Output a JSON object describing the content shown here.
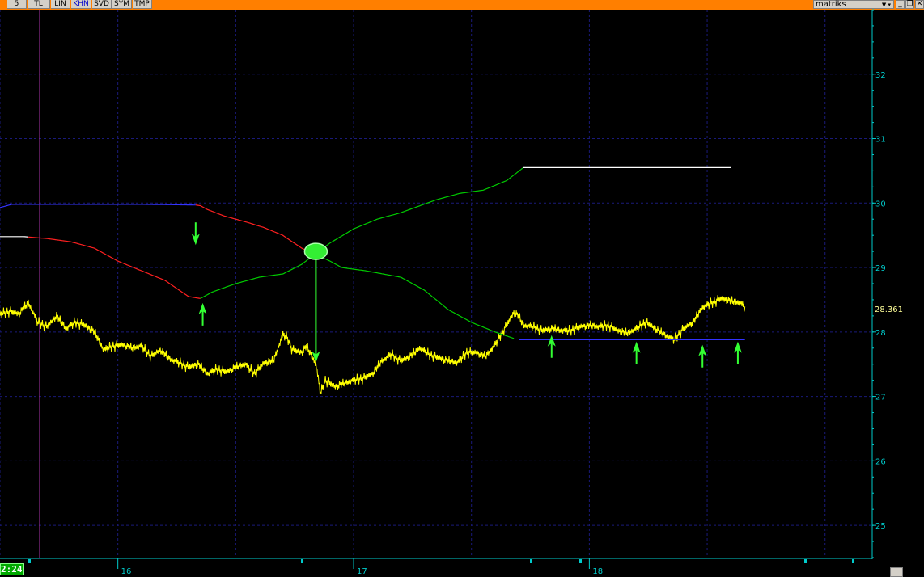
{
  "toolbar": {
    "buttons": [
      {
        "label": "5",
        "active": false
      },
      {
        "label": "TL",
        "active": false
      },
      {
        "label": "LIN",
        "active": false
      },
      {
        "label": "KHN",
        "active": true
      },
      {
        "label": "SVD",
        "active": false
      },
      {
        "label": "SYM",
        "active": false
      },
      {
        "label": "TMP",
        "active": false
      }
    ],
    "brand": "matriks",
    "brand_arrows": "▼ ▾",
    "window_buttons": [
      "_",
      "❐",
      "✕"
    ]
  },
  "status": {
    "time": "2:24"
  },
  "colors": {
    "background": "#000000",
    "price": "#ffff00",
    "channel_top": "#00cc00",
    "channel_bottom": "#ff2020",
    "level_line": "#3333ff",
    "annotation": "#33ff33",
    "axis": "#00cccc",
    "grid": "#1a1a7a"
  },
  "icons": [
    "arrow-down-icon",
    "arrow-up-icon",
    "crossover-marker-icon"
  ],
  "chart_data": {
    "type": "line",
    "title": "",
    "xlabel": "",
    "ylabel": "",
    "ylim": [
      24.5,
      33
    ],
    "yticks": [
      25,
      26,
      27,
      28,
      29,
      30,
      31,
      32
    ],
    "xlim": [
      15.5,
      19.2
    ],
    "xticks": [
      {
        "label": "16",
        "value": 16
      },
      {
        "label": "17",
        "value": 17
      },
      {
        "label": "18",
        "value": 18
      }
    ],
    "grid": true,
    "last_value": {
      "label": "28.361",
      "value": 28.361
    },
    "series": [
      {
        "role": "price",
        "color": "#ffff00",
        "points": [
          [
            15.5,
            28.27
          ],
          [
            15.54,
            28.32
          ],
          [
            15.58,
            28.28
          ],
          [
            15.62,
            28.45
          ],
          [
            15.66,
            28.15
          ],
          [
            15.7,
            28.08
          ],
          [
            15.74,
            28.25
          ],
          [
            15.78,
            28.05
          ],
          [
            15.82,
            28.15
          ],
          [
            15.86,
            28.1
          ],
          [
            15.9,
            28.0
          ],
          [
            15.94,
            27.72
          ],
          [
            15.98,
            27.78
          ],
          [
            16.02,
            27.8
          ],
          [
            16.06,
            27.75
          ],
          [
            16.1,
            27.78
          ],
          [
            16.14,
            27.62
          ],
          [
            16.18,
            27.72
          ],
          [
            16.22,
            27.58
          ],
          [
            16.26,
            27.52
          ],
          [
            16.3,
            27.45
          ],
          [
            16.34,
            27.5
          ],
          [
            16.38,
            27.35
          ],
          [
            16.42,
            27.42
          ],
          [
            16.46,
            27.38
          ],
          [
            16.5,
            27.45
          ],
          [
            16.54,
            27.5
          ],
          [
            16.58,
            27.35
          ],
          [
            16.62,
            27.52
          ],
          [
            16.66,
            27.55
          ],
          [
            16.7,
            27.96
          ],
          [
            16.72,
            27.9
          ],
          [
            16.74,
            27.72
          ],
          [
            16.78,
            27.68
          ],
          [
            16.8,
            27.78
          ],
          [
            16.84,
            27.5
          ],
          [
            16.86,
            27.05
          ],
          [
            16.88,
            27.25
          ],
          [
            16.92,
            27.15
          ],
          [
            16.96,
            27.2
          ],
          [
            17.0,
            27.25
          ],
          [
            17.04,
            27.28
          ],
          [
            17.08,
            27.35
          ],
          [
            17.12,
            27.55
          ],
          [
            17.16,
            27.65
          ],
          [
            17.2,
            27.55
          ],
          [
            17.24,
            27.62
          ],
          [
            17.28,
            27.75
          ],
          [
            17.32,
            27.65
          ],
          [
            17.36,
            27.6
          ],
          [
            17.4,
            27.55
          ],
          [
            17.44,
            27.52
          ],
          [
            17.48,
            27.68
          ],
          [
            17.52,
            27.68
          ],
          [
            17.56,
            27.62
          ],
          [
            17.6,
            27.8
          ],
          [
            17.64,
            28.05
          ],
          [
            17.68,
            28.3
          ],
          [
            17.7,
            28.25
          ],
          [
            17.72,
            28.1
          ],
          [
            17.76,
            28.08
          ],
          [
            17.8,
            28.02
          ],
          [
            17.84,
            28.05
          ],
          [
            17.88,
            28.02
          ],
          [
            17.92,
            28.02
          ],
          [
            17.96,
            28.08
          ],
          [
            18.0,
            28.1
          ],
          [
            18.04,
            28.08
          ],
          [
            18.08,
            28.1
          ],
          [
            18.12,
            28.02
          ],
          [
            18.16,
            27.98
          ],
          [
            18.2,
            28.05
          ],
          [
            18.24,
            28.15
          ],
          [
            18.28,
            28.05
          ],
          [
            18.32,
            27.95
          ],
          [
            18.36,
            27.88
          ],
          [
            18.4,
            28.05
          ],
          [
            18.44,
            28.15
          ],
          [
            18.48,
            28.38
          ],
          [
            18.52,
            28.45
          ],
          [
            18.56,
            28.52
          ],
          [
            18.6,
            28.48
          ],
          [
            18.64,
            28.45
          ],
          [
            18.66,
            28.38
          ]
        ],
        "noise": [
          0.06,
          -0.04,
          0.08,
          -0.07,
          0.03,
          -0.05,
          0.09,
          -0.02,
          0.05,
          -0.08,
          0.04,
          -0.03,
          0.07,
          -0.06,
          0.02,
          -0.09,
          0.06,
          -0.01,
          0.08,
          -0.05
        ]
      },
      {
        "role": "channel_top",
        "color": "#00cc00",
        "points": [
          [
            15.5,
            29.93
          ],
          [
            15.55,
            29.98
          ],
          [
            15.9,
            29.98
          ],
          [
            16.1,
            29.98
          ],
          [
            16.33,
            29.97
          ],
          [
            16.35,
            29.96
          ],
          [
            16.38,
            29.9
          ],
          [
            16.45,
            29.8
          ],
          [
            16.55,
            29.7
          ],
          [
            16.62,
            29.62
          ],
          [
            16.7,
            29.5
          ],
          [
            16.78,
            29.3
          ],
          [
            16.84,
            29.2
          ],
          [
            16.9,
            29.1
          ],
          [
            16.95,
            29.0
          ],
          [
            17.05,
            28.95
          ],
          [
            17.2,
            28.85
          ],
          [
            17.3,
            28.65
          ],
          [
            17.4,
            28.35
          ],
          [
            17.5,
            28.15
          ],
          [
            17.6,
            28.0
          ],
          [
            17.68,
            27.9
          ]
        ],
        "segments": [
          {
            "color": "#3333ff",
            "from": 15.5,
            "to": 16.33
          },
          {
            "color": "#ff2020",
            "from": 16.33,
            "to": 16.84
          },
          {
            "color": "#00cc00",
            "from": 16.84,
            "to": 17.68
          }
        ]
      },
      {
        "role": "lower_curve",
        "color": "#ff2020",
        "points": [
          [
            15.5,
            29.48
          ],
          [
            15.6,
            29.48
          ],
          [
            15.7,
            29.45
          ],
          [
            15.8,
            29.4
          ],
          [
            15.9,
            29.3
          ],
          [
            16.0,
            29.1
          ],
          [
            16.1,
            28.95
          ],
          [
            16.2,
            28.8
          ],
          [
            16.3,
            28.55
          ],
          [
            16.35,
            28.52
          ],
          [
            16.4,
            28.62
          ],
          [
            16.5,
            28.75
          ],
          [
            16.6,
            28.85
          ],
          [
            16.7,
            28.9
          ],
          [
            16.78,
            29.05
          ],
          [
            16.84,
            29.22
          ],
          [
            16.9,
            29.38
          ],
          [
            17.0,
            29.6
          ],
          [
            17.1,
            29.75
          ],
          [
            17.2,
            29.85
          ],
          [
            17.35,
            30.05
          ],
          [
            17.45,
            30.15
          ],
          [
            17.55,
            30.2
          ],
          [
            17.65,
            30.35
          ],
          [
            17.72,
            30.55
          ],
          [
            18.6,
            30.55
          ]
        ],
        "segments": [
          {
            "color": "#ffffff",
            "from": 15.5,
            "to": 15.62
          },
          {
            "color": "#ff2020",
            "from": 15.62,
            "to": 16.35
          },
          {
            "color": "#00cc00",
            "from": 16.35,
            "to": 17.72
          },
          {
            "color": "#ffffff",
            "from": 17.72,
            "to": 18.6
          }
        ]
      },
      {
        "role": "support_level",
        "color": "#3333ff",
        "points": [
          [
            17.7,
            27.88
          ],
          [
            18.66,
            27.88
          ]
        ]
      }
    ],
    "annotations": [
      {
        "type": "arrow-down",
        "x": 16.33,
        "y": 29.6
      },
      {
        "type": "arrow-up",
        "x": 16.36,
        "y": 28.2
      },
      {
        "type": "crossover",
        "x": 16.84,
        "y": 29.25
      },
      {
        "type": "long-arrow-down",
        "x": 16.84,
        "y_from": 29.22,
        "y_to": 27.55
      },
      {
        "type": "arrow-up",
        "x": 17.84,
        "y": 27.7
      },
      {
        "type": "arrow-up",
        "x": 18.2,
        "y": 27.6
      },
      {
        "type": "arrow-up",
        "x": 18.48,
        "y": 27.55
      },
      {
        "type": "arrow-up",
        "x": 18.63,
        "y": 27.6
      }
    ]
  }
}
